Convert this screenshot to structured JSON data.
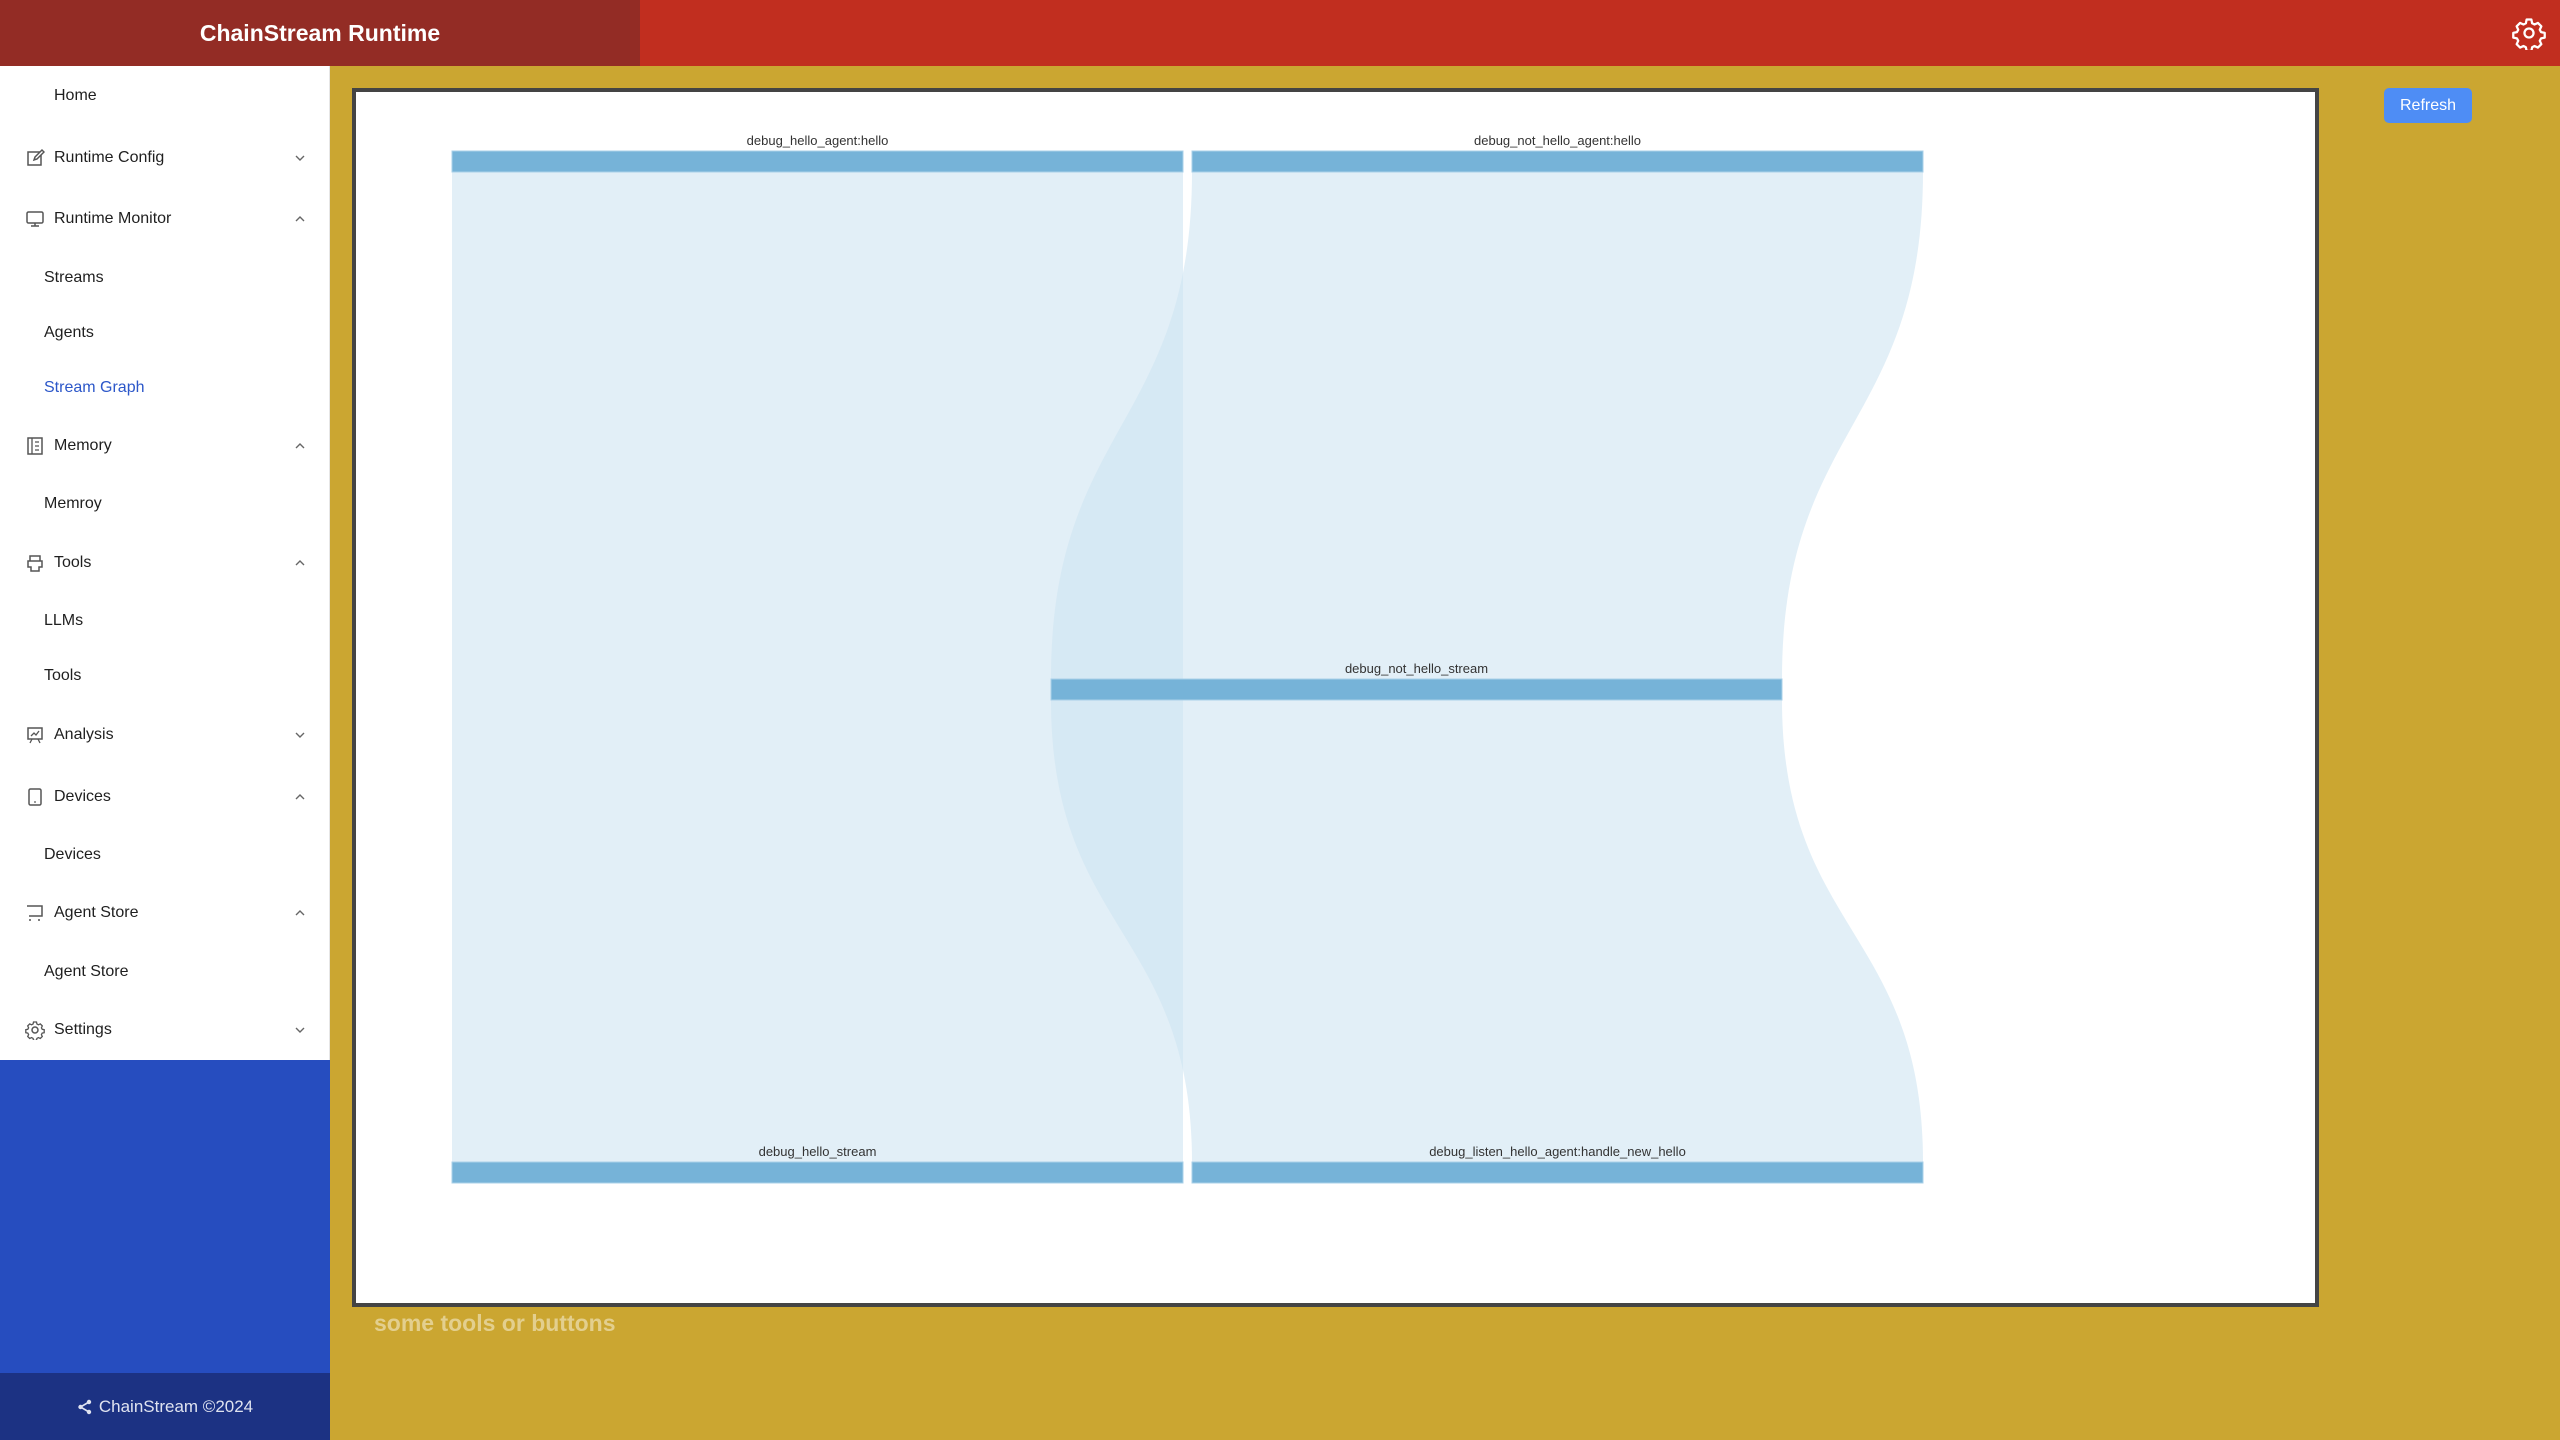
{
  "header": {
    "title": "ChainStream Runtime",
    "settings_icon": "gear-icon"
  },
  "sidebar": {
    "items": [
      {
        "label": "Home",
        "type": "item",
        "icon": null
      },
      {
        "label": "Runtime Config",
        "type": "group",
        "icon": "edit-icon",
        "expanded": false
      },
      {
        "label": "Runtime Monitor",
        "type": "group",
        "icon": "monitor-icon",
        "expanded": true
      },
      {
        "label": "Streams",
        "type": "sub"
      },
      {
        "label": "Agents",
        "type": "sub"
      },
      {
        "label": "Stream Graph",
        "type": "sub",
        "selected": true
      },
      {
        "label": "Memory",
        "type": "group",
        "icon": "book-icon",
        "expanded": true
      },
      {
        "label": "Memroy",
        "type": "sub"
      },
      {
        "label": "Tools",
        "type": "group",
        "icon": "printer-icon",
        "expanded": true
      },
      {
        "label": "LLMs",
        "type": "sub"
      },
      {
        "label": "Tools",
        "type": "sub"
      },
      {
        "label": "Analysis",
        "type": "group",
        "icon": "presentation-chart-icon",
        "expanded": false
      },
      {
        "label": "Devices",
        "type": "group",
        "icon": "tablet-icon",
        "expanded": true
      },
      {
        "label": "Devices",
        "type": "sub"
      },
      {
        "label": "Agent Store",
        "type": "group",
        "icon": "cart-icon",
        "expanded": true
      },
      {
        "label": "Agent Store",
        "type": "sub"
      },
      {
        "label": "Settings",
        "type": "group",
        "icon": "gear-icon",
        "expanded": false
      }
    ],
    "footer": "ChainStream ©2024"
  },
  "main": {
    "refresh_label": "Refresh",
    "tools_placeholder_text": "some tools or buttons"
  },
  "colors": {
    "header_brand": "#932C25",
    "header": "#C12E1F",
    "main_bg": "#CBA631",
    "sidebar_bottom": "#264DBF",
    "footer": "#1C3283",
    "node": "#76B3D8",
    "link": "#CFE4F1",
    "refresh": "#4E8DF5",
    "selected_menu": "#2C57C9"
  },
  "chart_data": {
    "type": "sankey",
    "orientation": "vertical",
    "nodes": [
      {
        "id": "debug_hello_agent:hello",
        "layer": 0
      },
      {
        "id": "debug_not_hello_agent:hello",
        "layer": 0
      },
      {
        "id": "debug_not_hello_stream",
        "layer": 1
      },
      {
        "id": "debug_hello_stream",
        "layer": 2
      },
      {
        "id": "debug_listen_hello_agent:handle_new_hello",
        "layer": 2
      }
    ],
    "links": [
      {
        "source": "debug_hello_agent:hello",
        "target": "debug_hello_stream",
        "value": 1
      },
      {
        "source": "debug_not_hello_agent:hello",
        "target": "debug_not_hello_stream",
        "value": 1
      },
      {
        "source": "debug_not_hello_stream",
        "target": "debug_listen_hello_agent:handle_new_hello",
        "value": 1
      }
    ]
  }
}
